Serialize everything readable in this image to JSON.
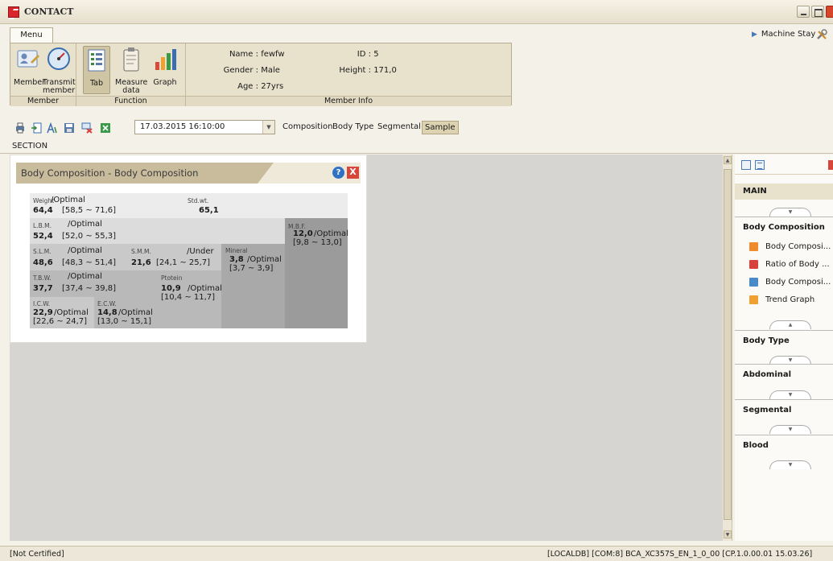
{
  "window": {
    "title": "CONTACT"
  },
  "menu_tab": "Menu",
  "machine_stay": "Machine Stay",
  "ribbon": {
    "buttons": {
      "member": "Member",
      "transmit": "Transmit member",
      "tab": "Tab",
      "measure": "Measure data",
      "graph": "Graph"
    },
    "groups": {
      "member": "Member",
      "function": "Function",
      "info": "Member Info"
    },
    "info": {
      "name_label": "Name :",
      "name": "fewfw",
      "gender_label": "Gender :",
      "gender": "Male",
      "age_label": "Age :",
      "age": "27yrs",
      "id_label": "ID :",
      "id": "5",
      "height_label": "Height :",
      "height": "171,0"
    }
  },
  "toolbar": {
    "date": "17.03.2015 16:10:00",
    "views": [
      "Composition",
      "Body Type",
      "Segmental",
      "Sample"
    ],
    "active_view": "Sample"
  },
  "section_label": "SECTION",
  "panel": {
    "title": "Body Composition - Body Composition",
    "help": "?",
    "close": "X",
    "cells": {
      "weight": {
        "label": "Weight",
        "value": "64,4",
        "status": "/Optimal",
        "range": "[58,5 ~ 71,6]"
      },
      "stdwt": {
        "label": "Std.wt.",
        "value": "65,1"
      },
      "lbm": {
        "label": "L.B.M.",
        "value": "52,4",
        "status": "/Optimal",
        "range": "[52,0 ~ 55,3]"
      },
      "mbf": {
        "label": "M.B.F.",
        "value": "12,0",
        "status": "/Optimal",
        "range": "[9,8 ~ 13,0]"
      },
      "slm": {
        "label": "S.L.M.",
        "value": "48,6",
        "status": "/Optimal",
        "range": "[48,3 ~ 51,4]"
      },
      "smm": {
        "label": "S.M.M.",
        "value": "21,6",
        "status": "/Under",
        "range": "[24,1 ~ 25,7]"
      },
      "mineral": {
        "label": "Mineral",
        "value": "3,8",
        "status": "/Optimal",
        "range": "[3,7 ~ 3,9]"
      },
      "tbw": {
        "label": "T.B.W.",
        "value": "37,7",
        "status": "/Optimal",
        "range": "[37,4 ~ 39,8]"
      },
      "protein": {
        "label": "Ptotein",
        "value": "10,9",
        "status": "/Optimal",
        "range": "[10,4 ~ 11,7]"
      },
      "icw": {
        "label": "I.C.W.",
        "value": "22,9",
        "status": "/Optimal",
        "range": "[22,6 ~ 24,7]"
      },
      "ecw": {
        "label": "E.C.W.",
        "value": "14,8",
        "status": "/Optimal",
        "range": "[13,0 ~ 15,1]"
      }
    }
  },
  "right_panel": {
    "main": "MAIN",
    "sections": {
      "body_composition": "Body Composition",
      "body_type": "Body Type",
      "abdominal": "Abdominal",
      "segmental": "Segmental",
      "blood": "Blood"
    },
    "items": [
      "Body Composi...",
      "Ratio of Body ...",
      "Body Composi...",
      "Trend Graph"
    ],
    "item_colors": [
      "#f08a2a",
      "#d8403a",
      "#4a8ac8",
      "#f0a030"
    ]
  },
  "status": {
    "left": "[Not Certified]",
    "right": "[LOCALDB]  [COM:8]  BCA_XC357S_EN_1_0_00 [CP.1.0.00.01 15.03.26]"
  }
}
